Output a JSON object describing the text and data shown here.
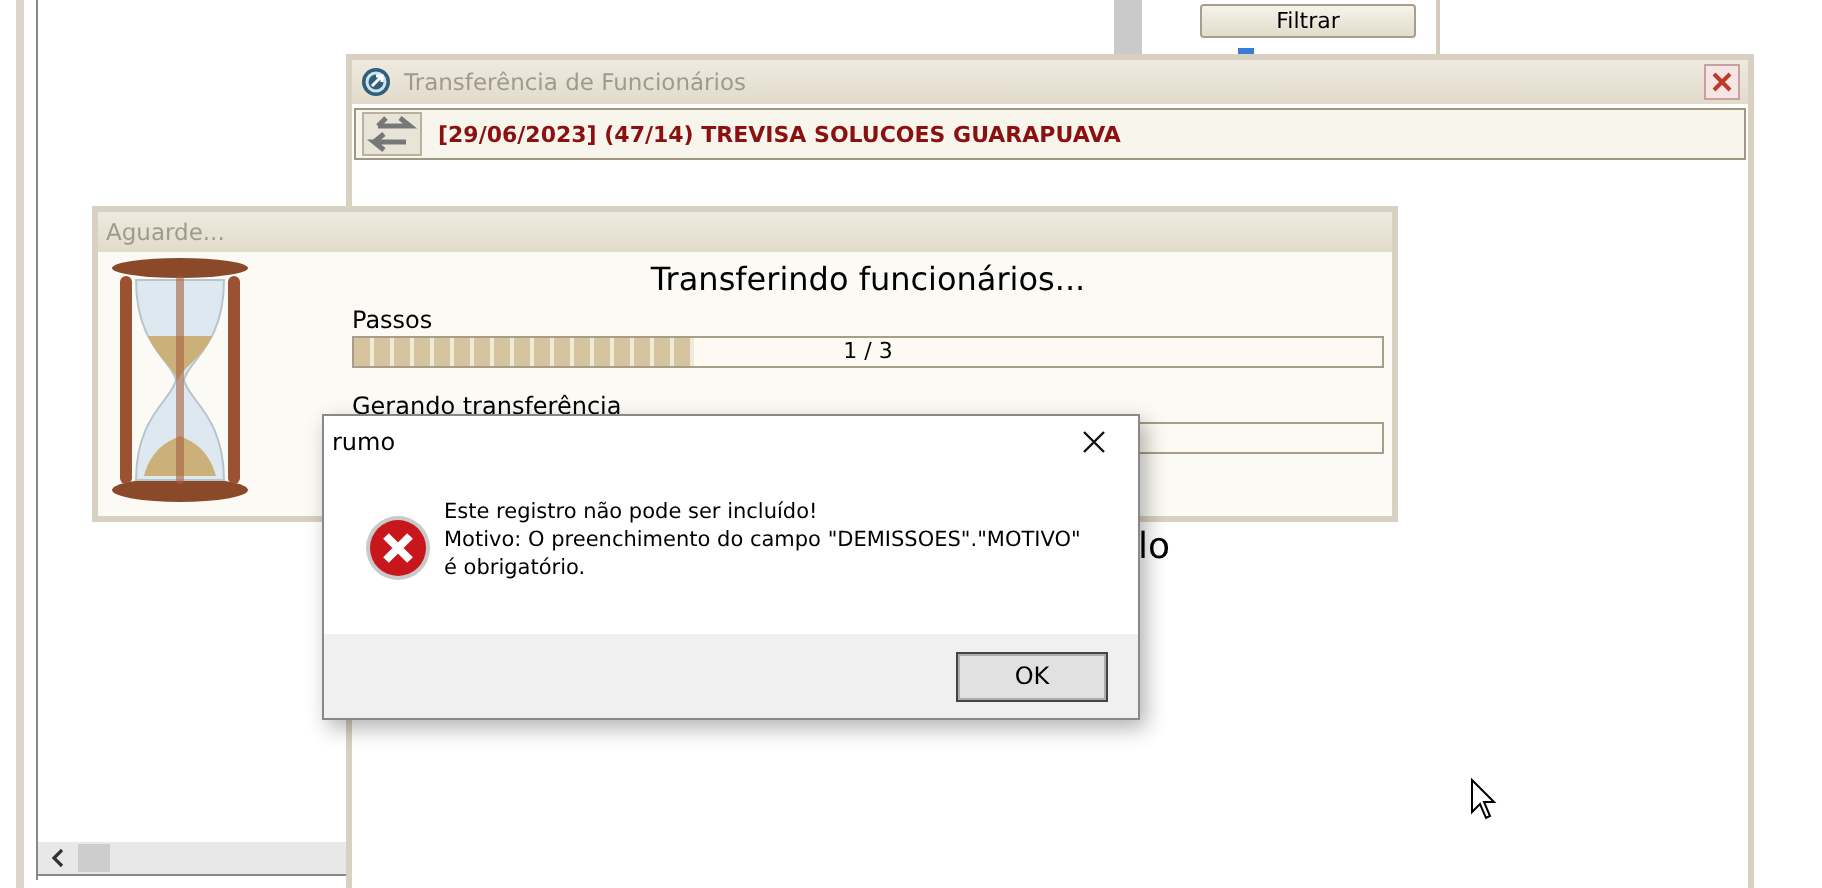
{
  "background_window": {
    "filter_button": "Filtrar"
  },
  "transfer_window": {
    "title": "Transferência de Funcionários",
    "header": "[29/06/2023] (47/14) TREVISA SOLUCOES GUARAPUAVA",
    "partial_text": "lo"
  },
  "progress_window": {
    "title": "Aguarde...",
    "heading": "Transferindo funcionários...",
    "steps": [
      {
        "label": "Passos",
        "level": 0.33,
        "reading": "1 / 3"
      },
      {
        "label": "Gerando transferência"
      }
    ]
  },
  "dialog": {
    "title": "rumo",
    "message_lines": [
      "Este registro não pode ser incluído!",
      "Motivo: O preenchimento do campo \"DEMISSOES\".\"MOTIVO\"",
      "é obrigatório."
    ],
    "buttons": [
      "OK"
    ]
  }
}
